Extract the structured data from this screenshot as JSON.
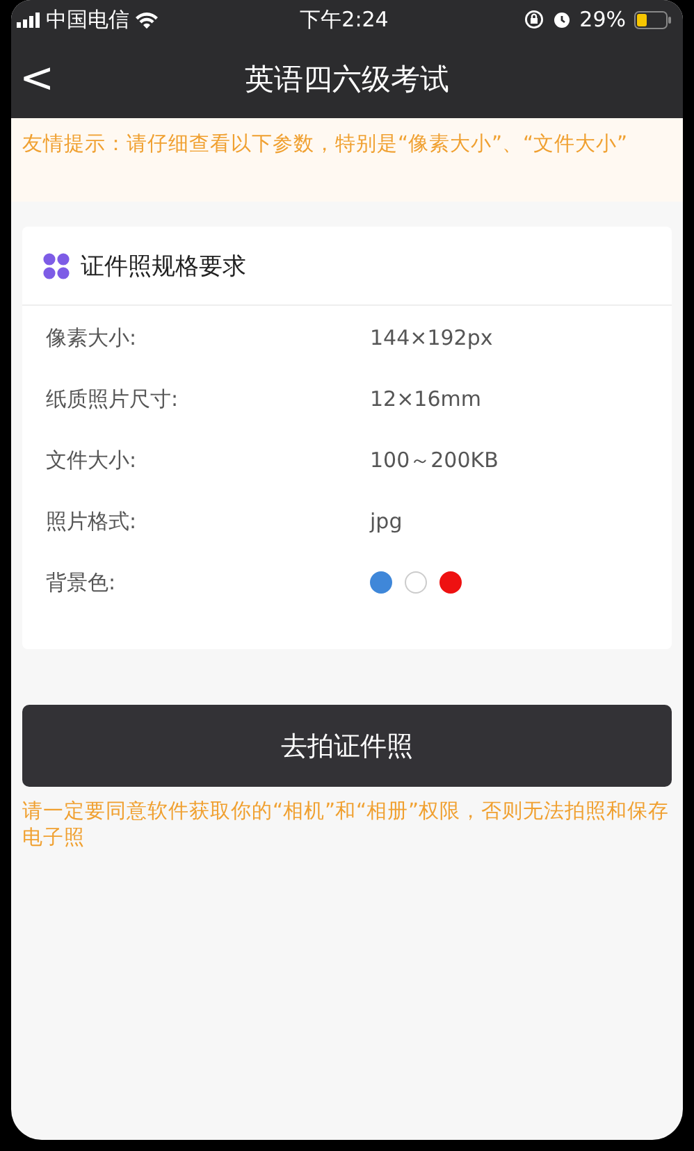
{
  "status_bar": {
    "carrier": "中国电信",
    "time": "下午2:24",
    "battery": "29%"
  },
  "nav": {
    "back": "<",
    "title": "英语四六级考试"
  },
  "notice": "友情提示：请仔细查看以下参数，特别是“像素大小”、“文件大小”",
  "spec_card": {
    "title": "证件照规格要求",
    "rows": [
      {
        "kind": "text",
        "label": "像素大小:",
        "value": "144×192px"
      },
      {
        "kind": "text",
        "label": "纸质照片尺寸:",
        "value": "12×16mm"
      },
      {
        "kind": "text",
        "label": "文件大小:",
        "value": "100～200KB"
      },
      {
        "kind": "text",
        "label": "照片格式:",
        "value": "jpg"
      },
      {
        "kind": "colors",
        "label": "背景色:",
        "colors": [
          {
            "color": "#3f87d9"
          },
          {
            "color": "#ffffff"
          },
          {
            "color": "#ee1111"
          }
        ]
      }
    ]
  },
  "action_button": "去拍证件照",
  "permission_note": "请一定要同意软件获取你的“相机”和“相册”权限，否则无法拍照和保存电子照"
}
